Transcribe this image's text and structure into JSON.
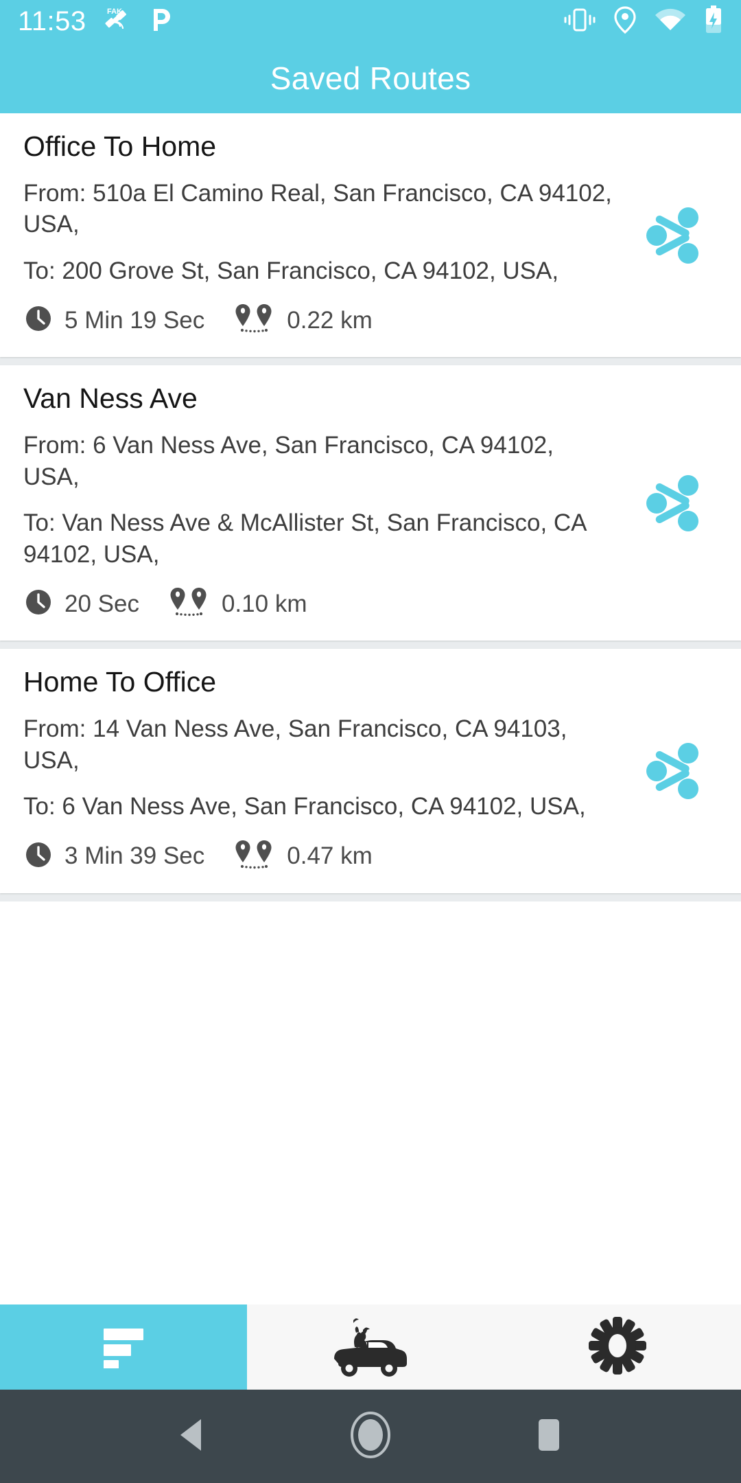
{
  "statusbar": {
    "time": "11:53",
    "icons_left": [
      "fake-gps-satellite-icon",
      "p-app-icon"
    ],
    "icons_right": [
      "vibrate-icon",
      "location-pin-icon",
      "wifi-icon",
      "battery-charging-icon"
    ]
  },
  "appbar": {
    "title": "Saved Routes",
    "background": "#5BCFE4"
  },
  "colors": {
    "accent": "#5BCFE4",
    "card_bg": "#FFFFFF",
    "page_bg": "#E9ECEE",
    "text_primary": "#151515",
    "text_secondary": "#3D3D3D",
    "meta_text": "#4A4A4A",
    "navbar_bg": "#3D474D",
    "tabbar_bg": "#F7F7F7"
  },
  "routes": [
    {
      "title": "Office To Home",
      "from": "From: 510a El Camino Real, San Francisco, CA 94102, USA,",
      "to": "To: 200 Grove St, San Francisco, CA 94102, USA,",
      "duration": "5 Min 19 Sec",
      "distance": "0.22 km",
      "share_label": "share-icon"
    },
    {
      "title": "Van Ness Ave",
      "from": "From: 6 Van Ness Ave, San Francisco, CA 94102, USA,",
      "to": "To: Van Ness Ave & McAllister St, San Francisco, CA 94102, USA,",
      "duration": "20 Sec",
      "distance": "0.10 km",
      "share_label": "share-icon"
    },
    {
      "title": "Home To Office",
      "from": "From: 14 Van Ness Ave, San Francisco, CA 94103, USA,",
      "to": "To: 6 Van Ness Ave, San Francisco, CA 94102, USA,",
      "duration": "3 Min 39 Sec",
      "distance": "0.47 km",
      "share_label": "share-icon"
    }
  ],
  "tabbar": {
    "items": [
      {
        "name": "saved-routes",
        "icon": "list-sort-icon",
        "active": true
      },
      {
        "name": "drive",
        "icon": "car-with-dog-icon",
        "active": false
      },
      {
        "name": "settings",
        "icon": "gear-icon",
        "active": false
      }
    ]
  },
  "navbar": {
    "items": [
      {
        "name": "back",
        "icon": "back-triangle-icon"
      },
      {
        "name": "home",
        "icon": "home-circle-icon"
      },
      {
        "name": "recents",
        "icon": "recents-square-icon"
      }
    ]
  }
}
